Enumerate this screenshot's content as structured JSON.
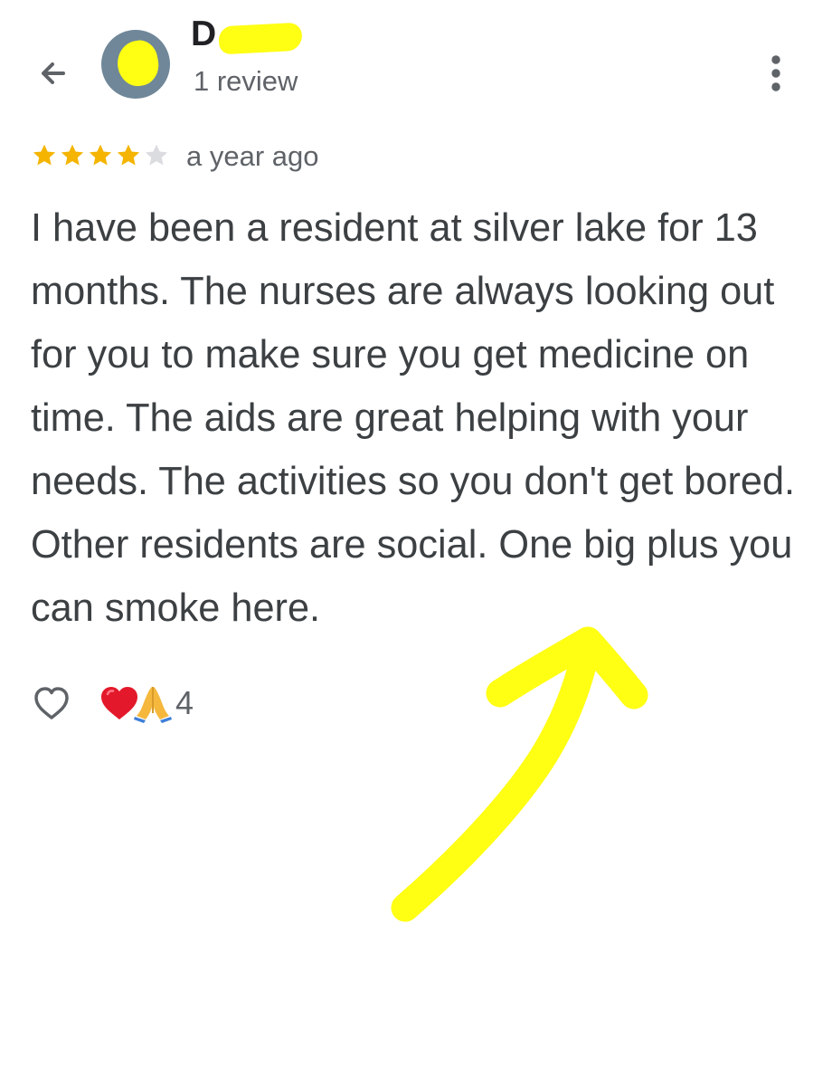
{
  "header": {
    "back_icon": "arrow-back-icon",
    "avatar_icon": "avatar-placeholder-icon",
    "reviewer_name_visible": "D",
    "review_count": "1 review",
    "more_icon": "more-vert-icon"
  },
  "review": {
    "rating": 4,
    "rating_max": 5,
    "date": "a year ago",
    "text": "I have been a resident at silver lake for 13 months. The nurses are always looking out for you to make sure you get medicine on time. The aids are great helping with your needs. The activities so you don't get bored. Other residents are social. One big plus you can smoke here."
  },
  "reactions": {
    "like_icon": "heart-outline-icon",
    "emojis": [
      "heart-emoji",
      "praying-hands-emoji"
    ],
    "count": "4"
  },
  "colors": {
    "star_filled": "#f4b400",
    "star_empty": "#dadce0",
    "highlight_yellow": "#ffff14",
    "avatar_bg": "#6f8799",
    "text_primary": "#202124",
    "text_body": "#3c4043",
    "text_secondary": "#5f6368"
  },
  "annotation": {
    "arrow_icon": "hand-drawn-yellow-arrow-icon"
  }
}
